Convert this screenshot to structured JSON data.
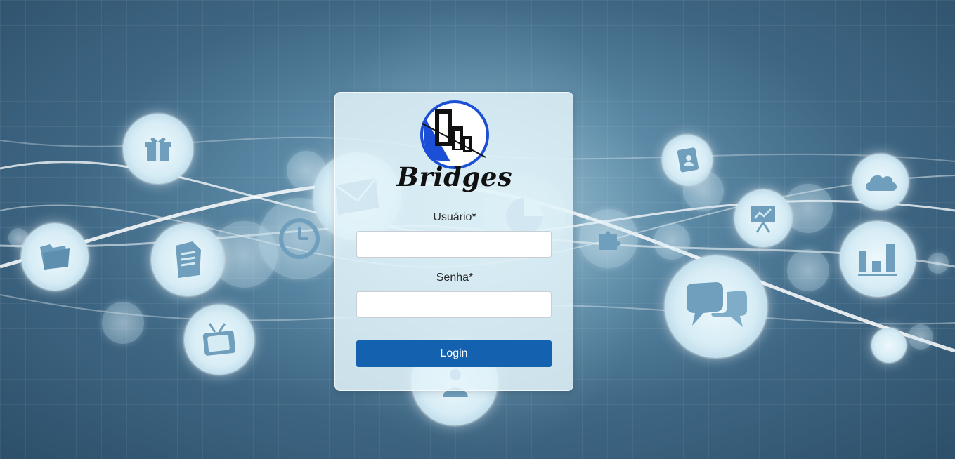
{
  "login": {
    "brand": "Bridges",
    "username_label": "Usuário*",
    "username_value": "",
    "password_label": "Senha*",
    "password_value": "",
    "button_label": "Login"
  },
  "colors": {
    "button": "#1461b0",
    "logo_blue": "#1a4fd6",
    "bubble_icon": "#6f9fbd"
  },
  "background_icons": [
    "gift-icon",
    "folder-icon",
    "document-icon",
    "tv-icon",
    "clock-icon",
    "envelope-icon",
    "pie-chart-icon",
    "puzzle-icon",
    "contacts-icon",
    "presentation-icon",
    "cloud-icon",
    "bar-chart-icon",
    "chat-icon",
    "user-icon"
  ]
}
